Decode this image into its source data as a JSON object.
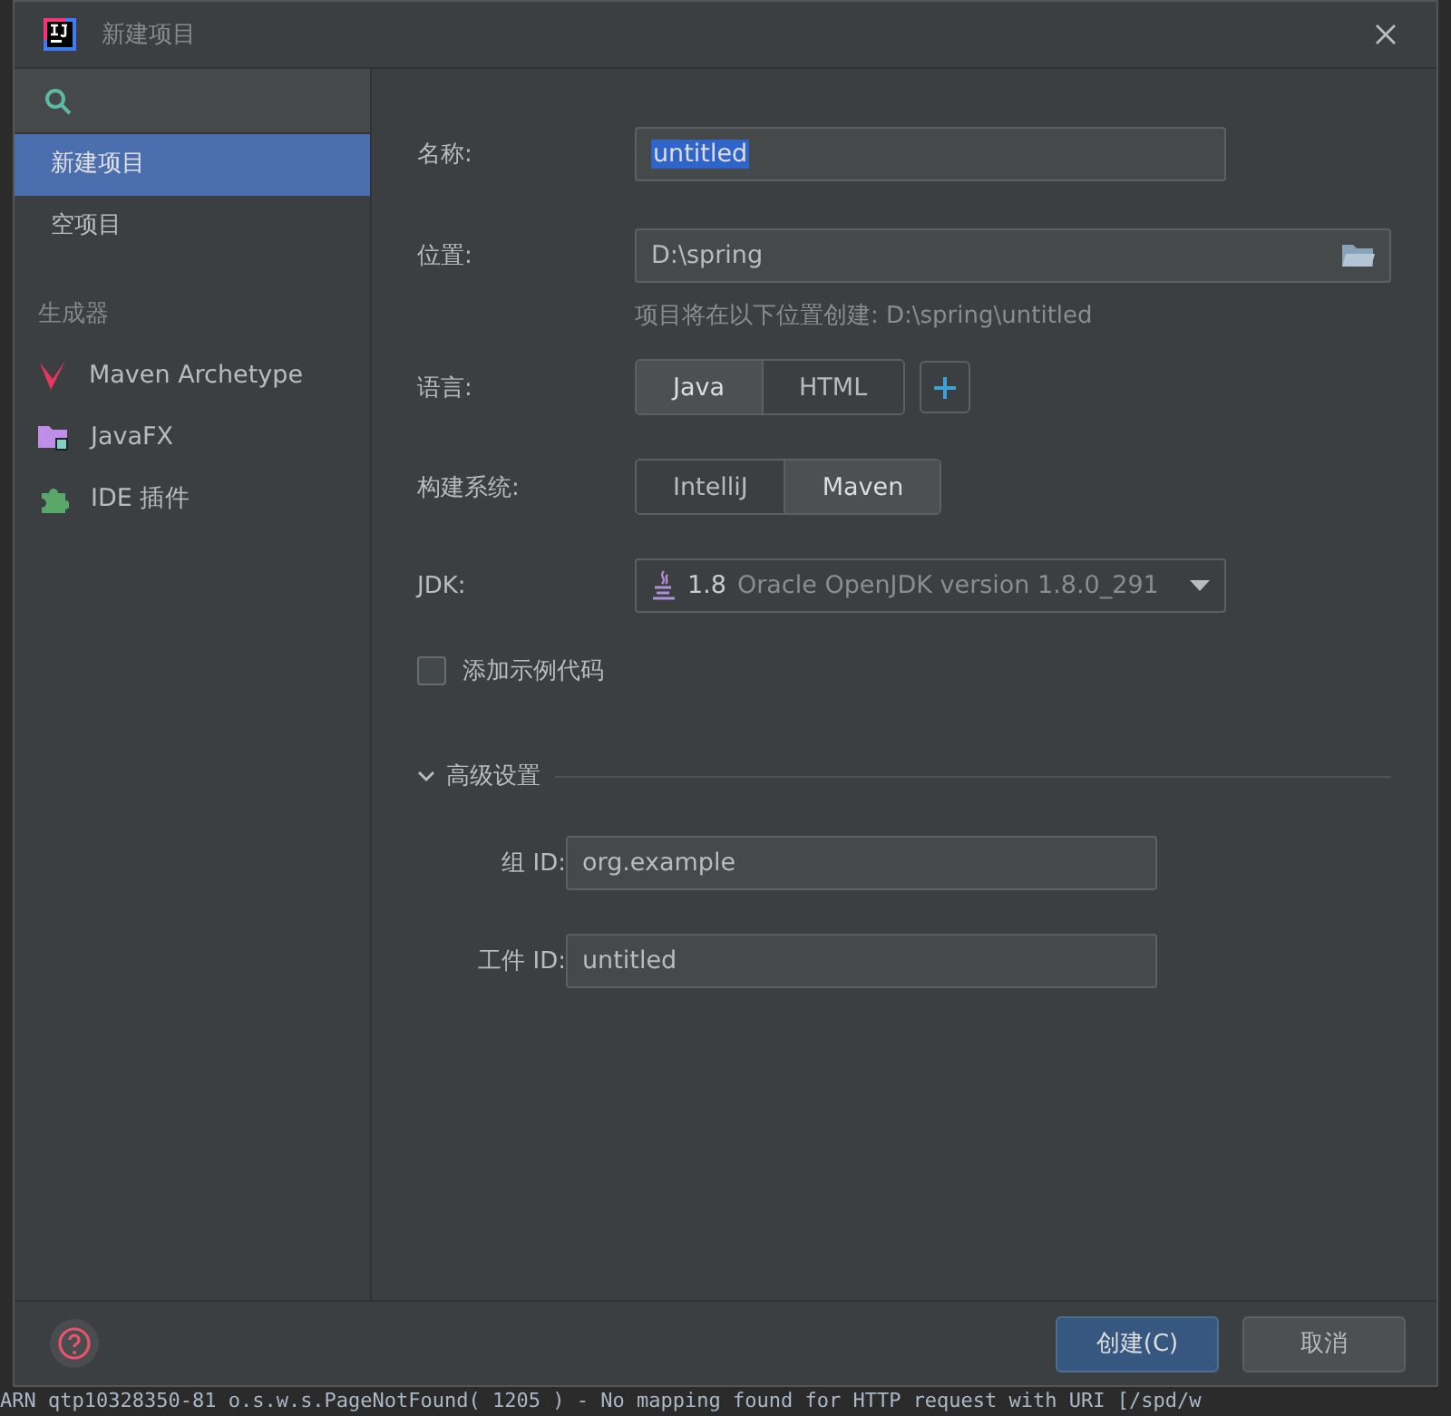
{
  "window": {
    "title": "新建项目"
  },
  "sidebar": {
    "items": [
      {
        "label": "新建项目",
        "selected": true
      },
      {
        "label": "空项目",
        "selected": false
      }
    ],
    "section": "生成器",
    "generators": [
      {
        "kind": "maven",
        "label": "Maven Archetype"
      },
      {
        "kind": "javafx",
        "label": "JavaFX"
      },
      {
        "kind": "plugin",
        "label": "IDE 插件"
      }
    ]
  },
  "form": {
    "name": {
      "label": "名称:",
      "value": "untitled",
      "text_selected": true
    },
    "location": {
      "label": "位置:",
      "value": "D:\\spring",
      "hint": "项目将在以下位置创建: D:\\spring\\untitled"
    },
    "language": {
      "label": "语言:",
      "options": [
        {
          "label": "Java",
          "selected": true
        },
        {
          "label": "HTML",
          "selected": false
        }
      ]
    },
    "build_system": {
      "label": "构建系统:",
      "options": [
        {
          "label": "IntelliJ",
          "selected": false
        },
        {
          "label": "Maven",
          "selected": true
        }
      ]
    },
    "jdk": {
      "label": "JDK:",
      "version": "1.8",
      "description": "Oracle OpenJDK version 1.8.0_291"
    },
    "sample_code": {
      "label": "添加示例代码",
      "checked": false
    },
    "advanced": {
      "title": "高级设置",
      "expanded": true,
      "fields": [
        {
          "label": "组 ID:",
          "value": "org.example"
        },
        {
          "label": "工件 ID:",
          "value": "untitled"
        }
      ]
    }
  },
  "buttons": [
    {
      "label": "创建(C)",
      "kind": "primary"
    },
    {
      "label": "取消",
      "kind": "secondary"
    }
  ],
  "background_log": "ARN qtp10328350-81 o.s.w.s.PageNotFound( 1205 ) - No mapping found for HTTP request with URI [/spd/w"
}
